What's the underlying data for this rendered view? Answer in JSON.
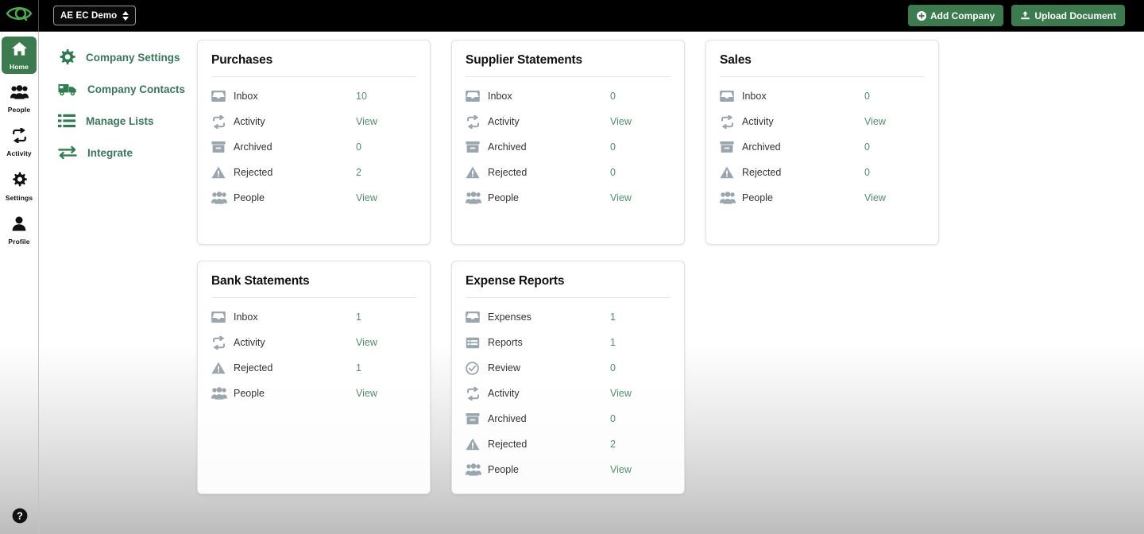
{
  "colors": {
    "brand_green": "#3c7b4e",
    "link_green": "#37785b",
    "value_green": "#4f8f6c",
    "topbar_bg": "#000000",
    "icon_gray": "#9aa6ae"
  },
  "topbar": {
    "logo_name": "eye-logo",
    "company_selector": "AE EC Demo",
    "add_company_label": "Add Company",
    "upload_document_label": "Upload Document"
  },
  "rail": {
    "items": [
      {
        "label": "Home",
        "icon": "home-icon",
        "active": true
      },
      {
        "label": "People",
        "icon": "people-icon",
        "active": false
      },
      {
        "label": "Activity",
        "icon": "activity-icon",
        "active": false
      },
      {
        "label": "Settings",
        "icon": "gear-icon",
        "active": false
      },
      {
        "label": "Profile",
        "icon": "profile-icon",
        "active": false
      }
    ],
    "help_icon": "help-circle-icon"
  },
  "nav": {
    "items": [
      {
        "label": "Company Settings",
        "icon": "gear-icon"
      },
      {
        "label": "Company Contacts",
        "icon": "truck-icon"
      },
      {
        "label": "Manage Lists",
        "icon": "list-icon"
      },
      {
        "label": "Integrate",
        "icon": "integrate-arrows-icon"
      }
    ]
  },
  "cards": {
    "row1": [
      {
        "title": "Purchases",
        "rows": [
          {
            "label": "Inbox",
            "value": "10",
            "icon": "inbox-icon",
            "link": false
          },
          {
            "label": "Activity",
            "value": "View",
            "icon": "activity-icon",
            "link": true
          },
          {
            "label": "Archived",
            "value": "0",
            "icon": "archive-icon",
            "link": false
          },
          {
            "label": "Rejected",
            "value": "2",
            "icon": "warning-icon",
            "link": false
          },
          {
            "label": "People",
            "value": "View",
            "icon": "people-icon",
            "link": true
          }
        ]
      },
      {
        "title": "Supplier Statements",
        "rows": [
          {
            "label": "Inbox",
            "value": "0",
            "icon": "inbox-icon",
            "link": false
          },
          {
            "label": "Activity",
            "value": "View",
            "icon": "activity-icon",
            "link": true
          },
          {
            "label": "Archived",
            "value": "0",
            "icon": "archive-icon",
            "link": false
          },
          {
            "label": "Rejected",
            "value": "0",
            "icon": "warning-icon",
            "link": false
          },
          {
            "label": "People",
            "value": "View",
            "icon": "people-icon",
            "link": true
          }
        ]
      },
      {
        "title": "Sales",
        "rows": [
          {
            "label": "Inbox",
            "value": "0",
            "icon": "inbox-icon",
            "link": false
          },
          {
            "label": "Activity",
            "value": "View",
            "icon": "activity-icon",
            "link": true
          },
          {
            "label": "Archived",
            "value": "0",
            "icon": "archive-icon",
            "link": false
          },
          {
            "label": "Rejected",
            "value": "0",
            "icon": "warning-icon",
            "link": false
          },
          {
            "label": "People",
            "value": "View",
            "icon": "people-icon",
            "link": true
          }
        ]
      }
    ],
    "row2": [
      {
        "title": "Bank Statements",
        "rows": [
          {
            "label": "Inbox",
            "value": "1",
            "icon": "inbox-icon",
            "link": false
          },
          {
            "label": "Activity",
            "value": "View",
            "icon": "activity-icon",
            "link": true
          },
          {
            "label": "Rejected",
            "value": "1",
            "icon": "warning-icon",
            "link": false
          },
          {
            "label": "People",
            "value": "View",
            "icon": "people-icon",
            "link": true
          }
        ]
      },
      {
        "title": "Expense Reports",
        "rows": [
          {
            "label": "Expenses",
            "value": "1",
            "icon": "inbox-icon",
            "link": false
          },
          {
            "label": "Reports",
            "value": "1",
            "icon": "list-box-icon",
            "link": false
          },
          {
            "label": "Review",
            "value": "0",
            "icon": "check-circle-icon",
            "link": false
          },
          {
            "label": "Activity",
            "value": "View",
            "icon": "activity-icon",
            "link": true
          },
          {
            "label": "Archived",
            "value": "0",
            "icon": "archive-icon",
            "link": false
          },
          {
            "label": "Rejected",
            "value": "2",
            "icon": "warning-icon",
            "link": false
          },
          {
            "label": "People",
            "value": "View",
            "icon": "people-icon",
            "link": true
          }
        ]
      }
    ]
  }
}
